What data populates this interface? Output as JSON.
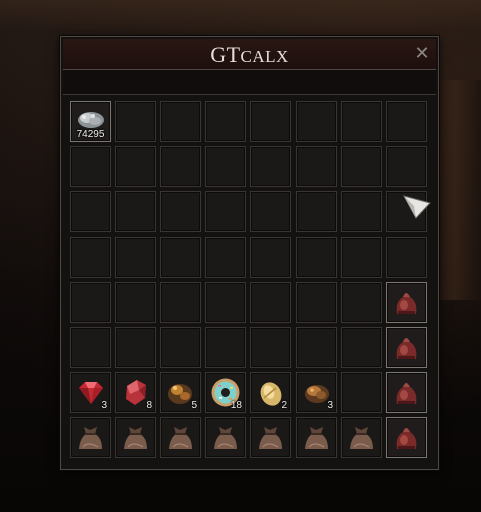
{
  "window": {
    "title_big": "GT",
    "title_small": "CALX",
    "close_label": "✕"
  },
  "grid": {
    "columns": 8,
    "rows": 8
  },
  "items": [
    {
      "row": 0,
      "col": 0,
      "name": "silver-ore",
      "icon": "silver-ore-icon",
      "qty": "74295",
      "filled": true
    },
    {
      "row": 6,
      "col": 0,
      "name": "ruby-gem",
      "icon": "ruby-icon",
      "qty": "3"
    },
    {
      "row": 6,
      "col": 1,
      "name": "red-crystal",
      "icon": "red-crystal-icon",
      "qty": "8"
    },
    {
      "row": 6,
      "col": 2,
      "name": "amber-ore",
      "icon": "amber-ore-icon",
      "qty": "5"
    },
    {
      "row": 6,
      "col": 3,
      "name": "donut-item",
      "icon": "donut-icon",
      "qty": "18"
    },
    {
      "row": 6,
      "col": 4,
      "name": "bread-item",
      "icon": "bread-icon",
      "qty": "2"
    },
    {
      "row": 6,
      "col": 5,
      "name": "brown-rock",
      "icon": "brown-rock-icon",
      "qty": "3"
    },
    {
      "row": 7,
      "col": 0,
      "name": "sack-1",
      "icon": "sack-icon"
    },
    {
      "row": 7,
      "col": 1,
      "name": "sack-2",
      "icon": "sack-icon"
    },
    {
      "row": 7,
      "col": 2,
      "name": "sack-3",
      "icon": "sack-icon"
    },
    {
      "row": 7,
      "col": 3,
      "name": "sack-4",
      "icon": "sack-icon"
    },
    {
      "row": 7,
      "col": 4,
      "name": "sack-5",
      "icon": "sack-icon"
    },
    {
      "row": 7,
      "col": 5,
      "name": "sack-6",
      "icon": "sack-icon"
    },
    {
      "row": 7,
      "col": 6,
      "name": "sack-7",
      "icon": "sack-icon"
    },
    {
      "row": 4,
      "col": 7,
      "name": "red-bag-1",
      "icon": "red-bag-icon",
      "filled": true
    },
    {
      "row": 5,
      "col": 7,
      "name": "red-bag-2",
      "icon": "red-bag-icon",
      "filled": true
    },
    {
      "row": 6,
      "col": 7,
      "name": "red-bag-3",
      "icon": "red-bag-icon",
      "filled": true
    },
    {
      "row": 7,
      "col": 7,
      "name": "red-bag-4",
      "icon": "red-bag-icon",
      "filled": true
    }
  ]
}
